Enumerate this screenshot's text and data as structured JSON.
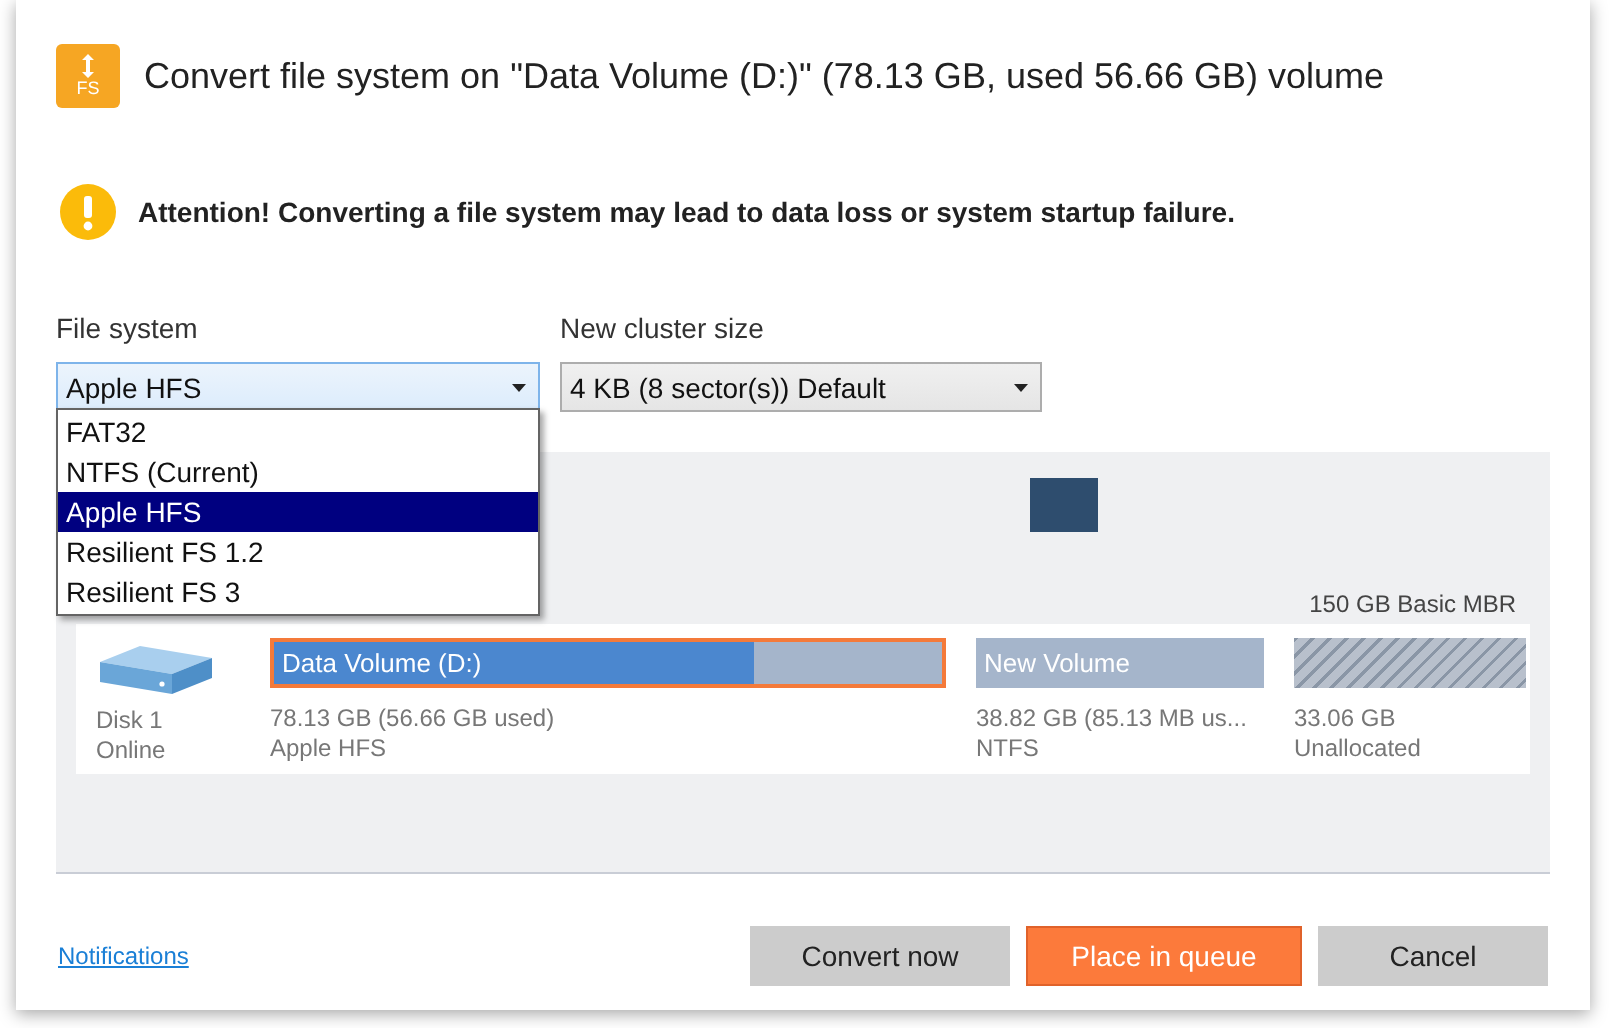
{
  "dialog": {
    "title": "Convert file system on \"Data Volume (D:)\" (78.13 GB, used 56.66 GB) volume",
    "icon_text": "FS"
  },
  "warning": "Attention! Converting a file system may lead to data loss or system startup failure.",
  "file_system": {
    "label": "File system",
    "value": "Apple HFS",
    "expanded": true,
    "options": [
      {
        "label": "FAT32",
        "selected": false
      },
      {
        "label": "NTFS (Current)",
        "selected": false
      },
      {
        "label": "Apple HFS",
        "selected": true
      },
      {
        "label": "Resilient FS 1.2",
        "selected": false
      },
      {
        "label": "Resilient FS 3",
        "selected": false
      }
    ]
  },
  "cluster_size": {
    "label": "New cluster size",
    "value": "4 KB (8 sector(s)) Default"
  },
  "disk": {
    "info": "150 GB Basic MBR",
    "name": "Disk 1",
    "status": "Online",
    "partitions": [
      {
        "kind": "volume",
        "name": "Data Volume (D:)",
        "size": "78.13 GB (56.66 GB used)",
        "fs": "Apple HFS",
        "level": 0.72,
        "selected": true
      },
      {
        "kind": "volume",
        "name": "New Volume",
        "size": "38.82 GB (85.13 MB us...",
        "fs": "NTFS",
        "selected": false
      },
      {
        "kind": "unallocated",
        "size": "33.06 GB",
        "fs": "Unallocated",
        "selected": false
      }
    ]
  },
  "notifications_link": "Notifications",
  "buttons": [
    {
      "label": "Convert now",
      "kind": "secondary"
    },
    {
      "label": "Place in queue",
      "kind": "primary"
    },
    {
      "label": "Cancel",
      "kind": "secondary"
    }
  ]
}
